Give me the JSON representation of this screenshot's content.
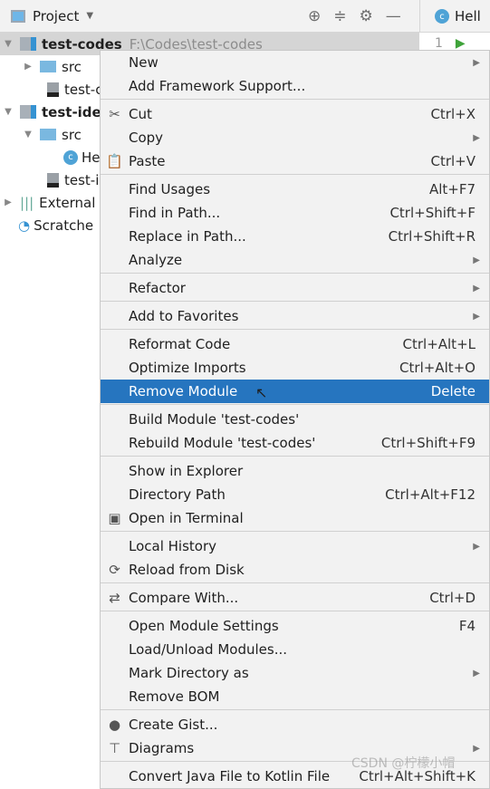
{
  "toolbar": {
    "title": "Project",
    "icons": [
      "crosshair-icon",
      "collapse-icon",
      "gear-icon",
      "minimize-icon"
    ]
  },
  "editor_tab": {
    "label": "Hell",
    "line": "1"
  },
  "tree": [
    {
      "label": "test-codes",
      "path": "F:\\Codes\\test-codes"
    },
    {
      "label": "src"
    },
    {
      "label": "test-c"
    },
    {
      "label": "test-idea"
    },
    {
      "label": "src"
    },
    {
      "label": "He"
    },
    {
      "label": "test-i"
    },
    {
      "label": "External"
    },
    {
      "label": "Scratche"
    }
  ],
  "menu": [
    {
      "label": "New",
      "submenu": true
    },
    {
      "label": "Add Framework Support..."
    },
    {
      "label": "Cut",
      "shortcut": "Ctrl+X",
      "icon": "scissors-icon"
    },
    {
      "label": "Copy",
      "submenu": true
    },
    {
      "label": "Paste",
      "shortcut": "Ctrl+V",
      "icon": "clipboard-icon"
    },
    {
      "label": "Find Usages",
      "shortcut": "Alt+F7"
    },
    {
      "label": "Find in Path...",
      "shortcut": "Ctrl+Shift+F"
    },
    {
      "label": "Replace in Path...",
      "shortcut": "Ctrl+Shift+R"
    },
    {
      "label": "Analyze",
      "submenu": true
    },
    {
      "label": "Refactor",
      "submenu": true
    },
    {
      "label": "Add to Favorites",
      "submenu": true
    },
    {
      "label": "Reformat Code",
      "shortcut": "Ctrl+Alt+L"
    },
    {
      "label": "Optimize Imports",
      "shortcut": "Ctrl+Alt+O"
    },
    {
      "label": "Remove Module",
      "shortcut": "Delete",
      "highlighted": true
    },
    {
      "label": "Build Module 'test-codes'"
    },
    {
      "label": "Rebuild Module 'test-codes'",
      "shortcut": "Ctrl+Shift+F9"
    },
    {
      "label": "Show in Explorer"
    },
    {
      "label": "Directory Path",
      "shortcut": "Ctrl+Alt+F12"
    },
    {
      "label": "Open in Terminal",
      "icon": "terminal-icon"
    },
    {
      "label": "Local History",
      "submenu": true
    },
    {
      "label": "Reload from Disk",
      "icon": "reload-icon"
    },
    {
      "label": "Compare With...",
      "shortcut": "Ctrl+D",
      "icon": "compare-icon"
    },
    {
      "label": "Open Module Settings",
      "shortcut": "F4"
    },
    {
      "label": "Load/Unload Modules..."
    },
    {
      "label": "Mark Directory as",
      "submenu": true
    },
    {
      "label": "Remove BOM"
    },
    {
      "label": "Create Gist...",
      "icon": "github-icon"
    },
    {
      "label": "Diagrams",
      "submenu": true,
      "icon": "diagram-icon"
    },
    {
      "label": "Convert Java File to Kotlin File",
      "shortcut": "Ctrl+Alt+Shift+K"
    }
  ],
  "watermark": "CSDN @柠檬小帽",
  "colors": {
    "highlight": "#2675bf",
    "menu_bg": "#f2f2f2"
  }
}
